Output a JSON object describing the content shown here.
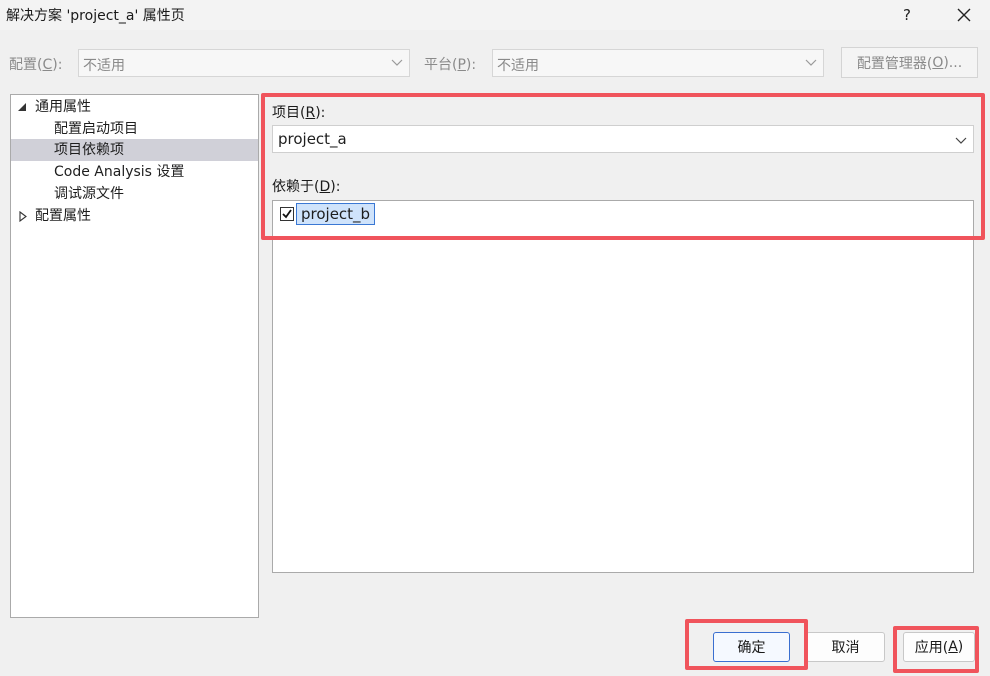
{
  "window": {
    "title": "解决方案 'project_a' 属性页",
    "help_glyph": "?",
    "close_glyph": "✕"
  },
  "config_bar": {
    "config_label": "配置(",
    "config_key": "C",
    "config_label_end": "):",
    "config_value": "不适用",
    "platform_label": "平台(",
    "platform_key": "P",
    "platform_label_end": "):",
    "platform_value": "不适用",
    "manager_label": "配置管理器(",
    "manager_key": "O",
    "manager_label_end": ")..."
  },
  "tree": {
    "common": "通用属性",
    "items": [
      "配置启动项目",
      "项目依赖项",
      "Code Analysis 设置",
      "调试源文件"
    ],
    "selected_index": 1,
    "config": "配置属性"
  },
  "main": {
    "project_label": "项目(",
    "project_key": "R",
    "project_label_end": "):",
    "project_value": "project_a",
    "depends_label": "依赖于(",
    "depends_key": "D",
    "depends_label_end": "):",
    "dependencies": [
      {
        "name": "project_b",
        "checked": true
      }
    ]
  },
  "buttons": {
    "ok": "确定",
    "cancel": "取消",
    "apply": "应用(",
    "apply_key": "A",
    "apply_end": ")"
  },
  "colors": {
    "highlight_box": "#f0545c",
    "selection_bg": "#d0d0d8",
    "item_selection": "#cfe3fb"
  }
}
